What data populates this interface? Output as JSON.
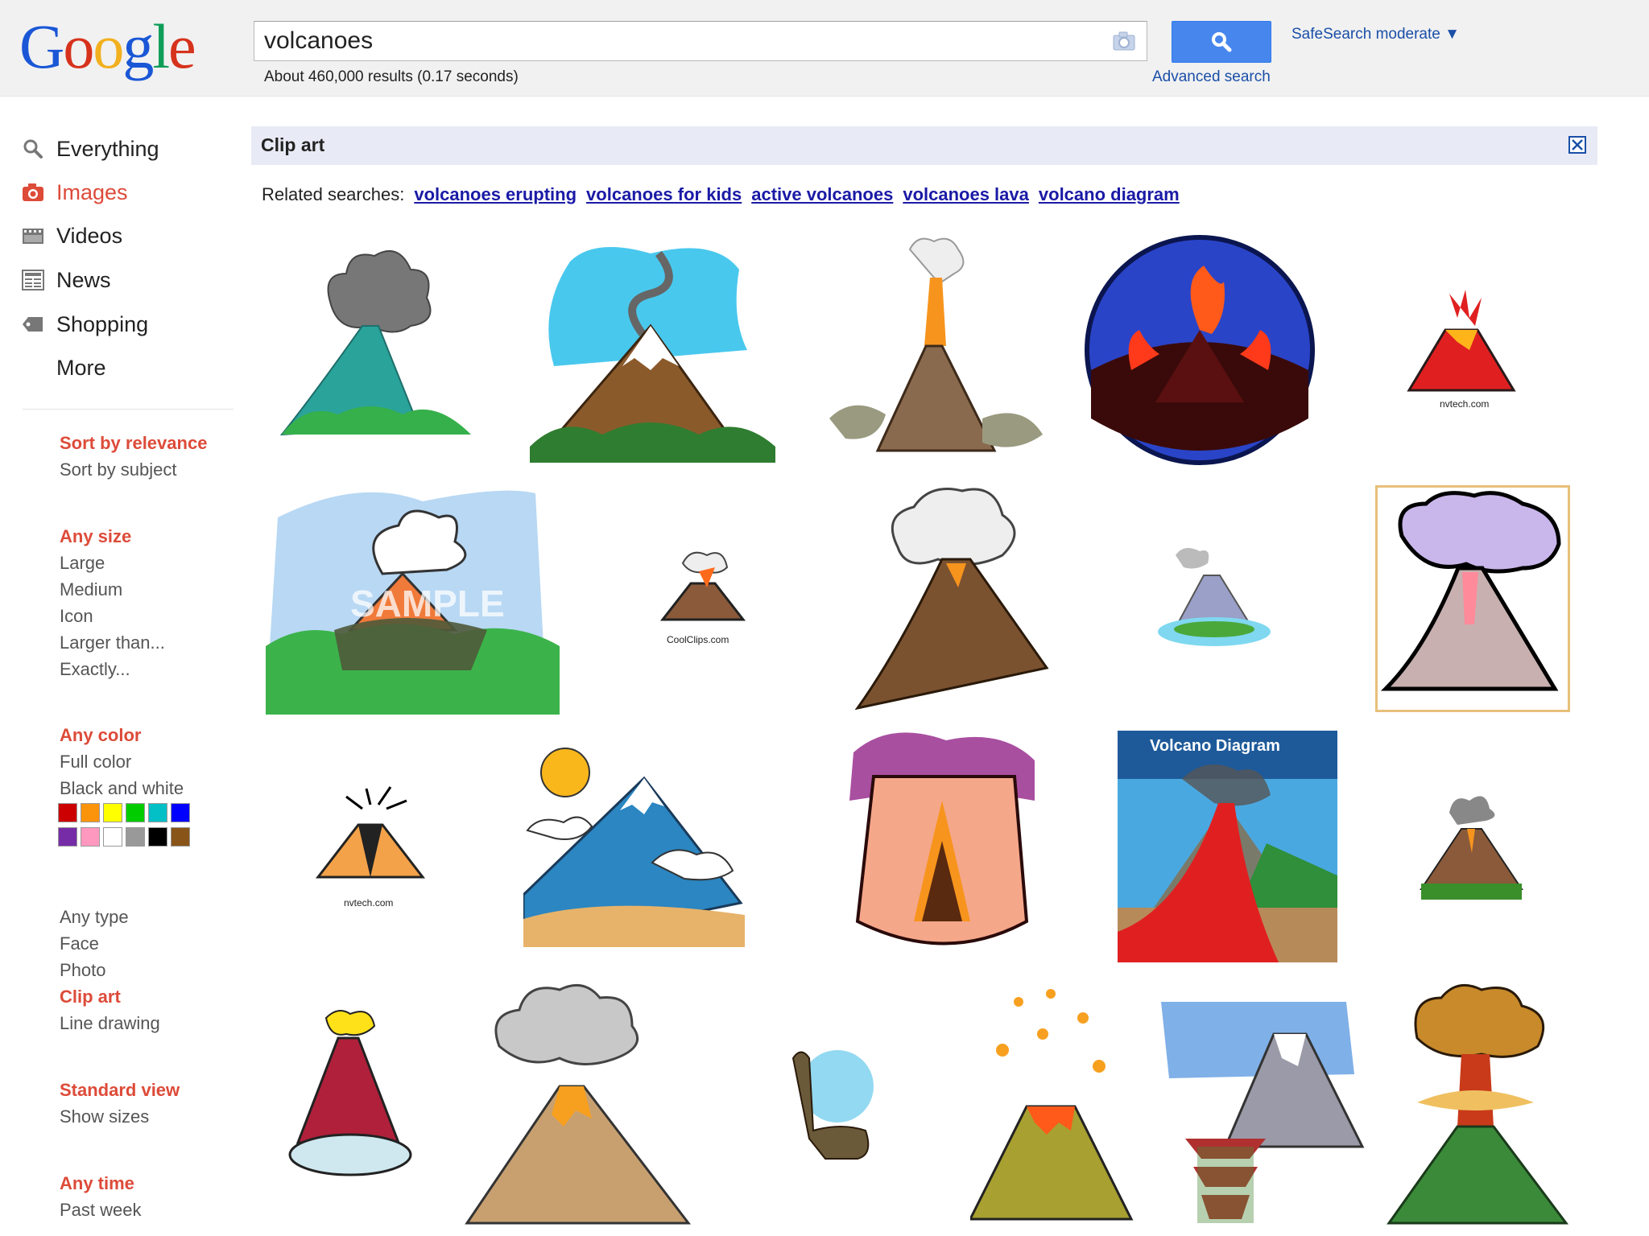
{
  "logo": {
    "letters": [
      "G",
      "o",
      "o",
      "g",
      "l",
      "e"
    ],
    "colors": [
      "#1a57d6",
      "#d6321c",
      "#f2b01e",
      "#1a57d6",
      "#0f9d58",
      "#d6321c"
    ]
  },
  "search": {
    "query": "volcanoes",
    "button_icon": "search-icon",
    "camera_icon": "camera-icon"
  },
  "header": {
    "result_stats": "About 460,000 results (0.17 seconds)",
    "advanced_search": "Advanced search",
    "safesearch": "SafeSearch moderate ▼"
  },
  "nav": {
    "items": [
      {
        "label": "Everything",
        "icon": "search-icon",
        "selected": false
      },
      {
        "label": "Images",
        "icon": "camera-icon",
        "selected": true
      },
      {
        "label": "Videos",
        "icon": "film-icon",
        "selected": false
      },
      {
        "label": "News",
        "icon": "newspaper-icon",
        "selected": false
      },
      {
        "label": "Shopping",
        "icon": "tag-icon",
        "selected": false
      },
      {
        "label": "More",
        "icon": "",
        "selected": false
      }
    ]
  },
  "tools": {
    "sort": [
      "Sort by relevance",
      "Sort by subject"
    ],
    "size": [
      "Any size",
      "Large",
      "Medium",
      "Icon",
      "Larger than...",
      "Exactly..."
    ],
    "color": [
      "Any color",
      "Full color",
      "Black and white"
    ],
    "color_swatches": [
      "#cc0000",
      "#fb940b",
      "#ffff00",
      "#00cc00",
      "#03c0c6",
      "#0000ff",
      "#762ca7",
      "#ff98bf",
      "#ffffff",
      "#999999",
      "#000000",
      "#885418"
    ],
    "type": [
      "Any type",
      "Face",
      "Photo",
      "Clip art",
      "Line drawing"
    ],
    "view": [
      "Standard view",
      "Show sizes"
    ],
    "time": [
      "Any time",
      "Past week"
    ]
  },
  "main": {
    "clipart_title": "Clip art",
    "related_label": "Related searches:",
    "related": [
      "volcanoes erupting",
      "volcanoes for kids",
      "active volcanoes",
      "volcanoes lava",
      "volcano diagram"
    ],
    "thumb_texts": {
      "nvtech1": "nvtech.com",
      "coolclips": "CoolClips.com",
      "sample": "SAMPLE",
      "diagram_title": "Volcano Diagram",
      "nvtech2": "nvtech.com"
    }
  }
}
